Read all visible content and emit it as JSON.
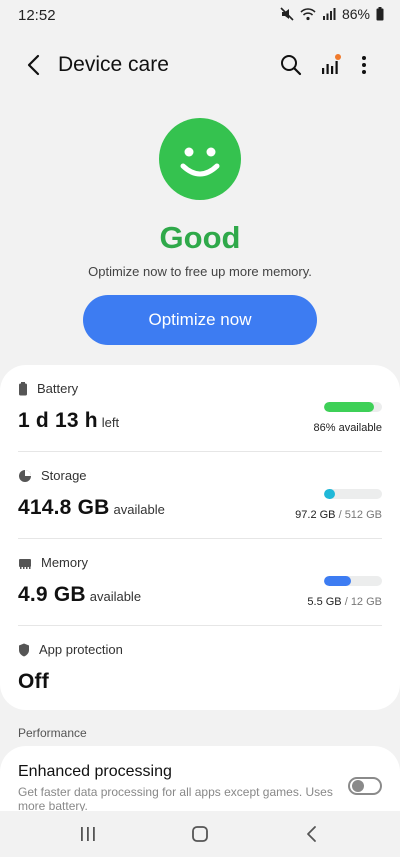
{
  "status_bar": {
    "time": "12:52",
    "battery_percent": "86%"
  },
  "app_bar": {
    "title": "Device care",
    "icons": [
      "back-arrow-icon",
      "search-icon",
      "signal-chart-icon",
      "more-vertical-icon"
    ],
    "notification_dot_color": "#f07a2c"
  },
  "hero": {
    "icon": "smiley-face-icon",
    "status": "Good",
    "status_color": "#2fa94a",
    "message": "Optimize now to free up more memory.",
    "button_label": "Optimize now",
    "button_color": "#3d7cf2"
  },
  "items": {
    "battery": {
      "label": "Battery",
      "icon": "battery-icon",
      "value": "1 d 13 h",
      "unit": "left",
      "level": 0.86,
      "bar_color": "#3ed057",
      "note": "86% available"
    },
    "storage": {
      "label": "Storage",
      "icon": "pie-chart-icon",
      "value": "414.8 GB",
      "unit": "available",
      "level": 0.19,
      "bar_color": "#1fb8d8",
      "used": "97.2 GB",
      "total": "/ 512 GB"
    },
    "memory": {
      "label": "Memory",
      "icon": "memory-chip-icon",
      "value": "4.9 GB",
      "unit": "available",
      "level": 0.46,
      "bar_color": "#3d7cf2",
      "used": "5.5 GB",
      "total": "/ 12 GB"
    },
    "app_protection": {
      "label": "App protection",
      "icon": "shield-icon",
      "value": "Off"
    }
  },
  "performance": {
    "header": "Performance",
    "title": "Enhanced processing",
    "description": "Get faster data processing for all apps except games. Uses more battery.",
    "toggle_on": false
  },
  "nav_bar": {
    "icons": [
      "recent-apps-icon",
      "home-icon",
      "back-icon"
    ]
  }
}
